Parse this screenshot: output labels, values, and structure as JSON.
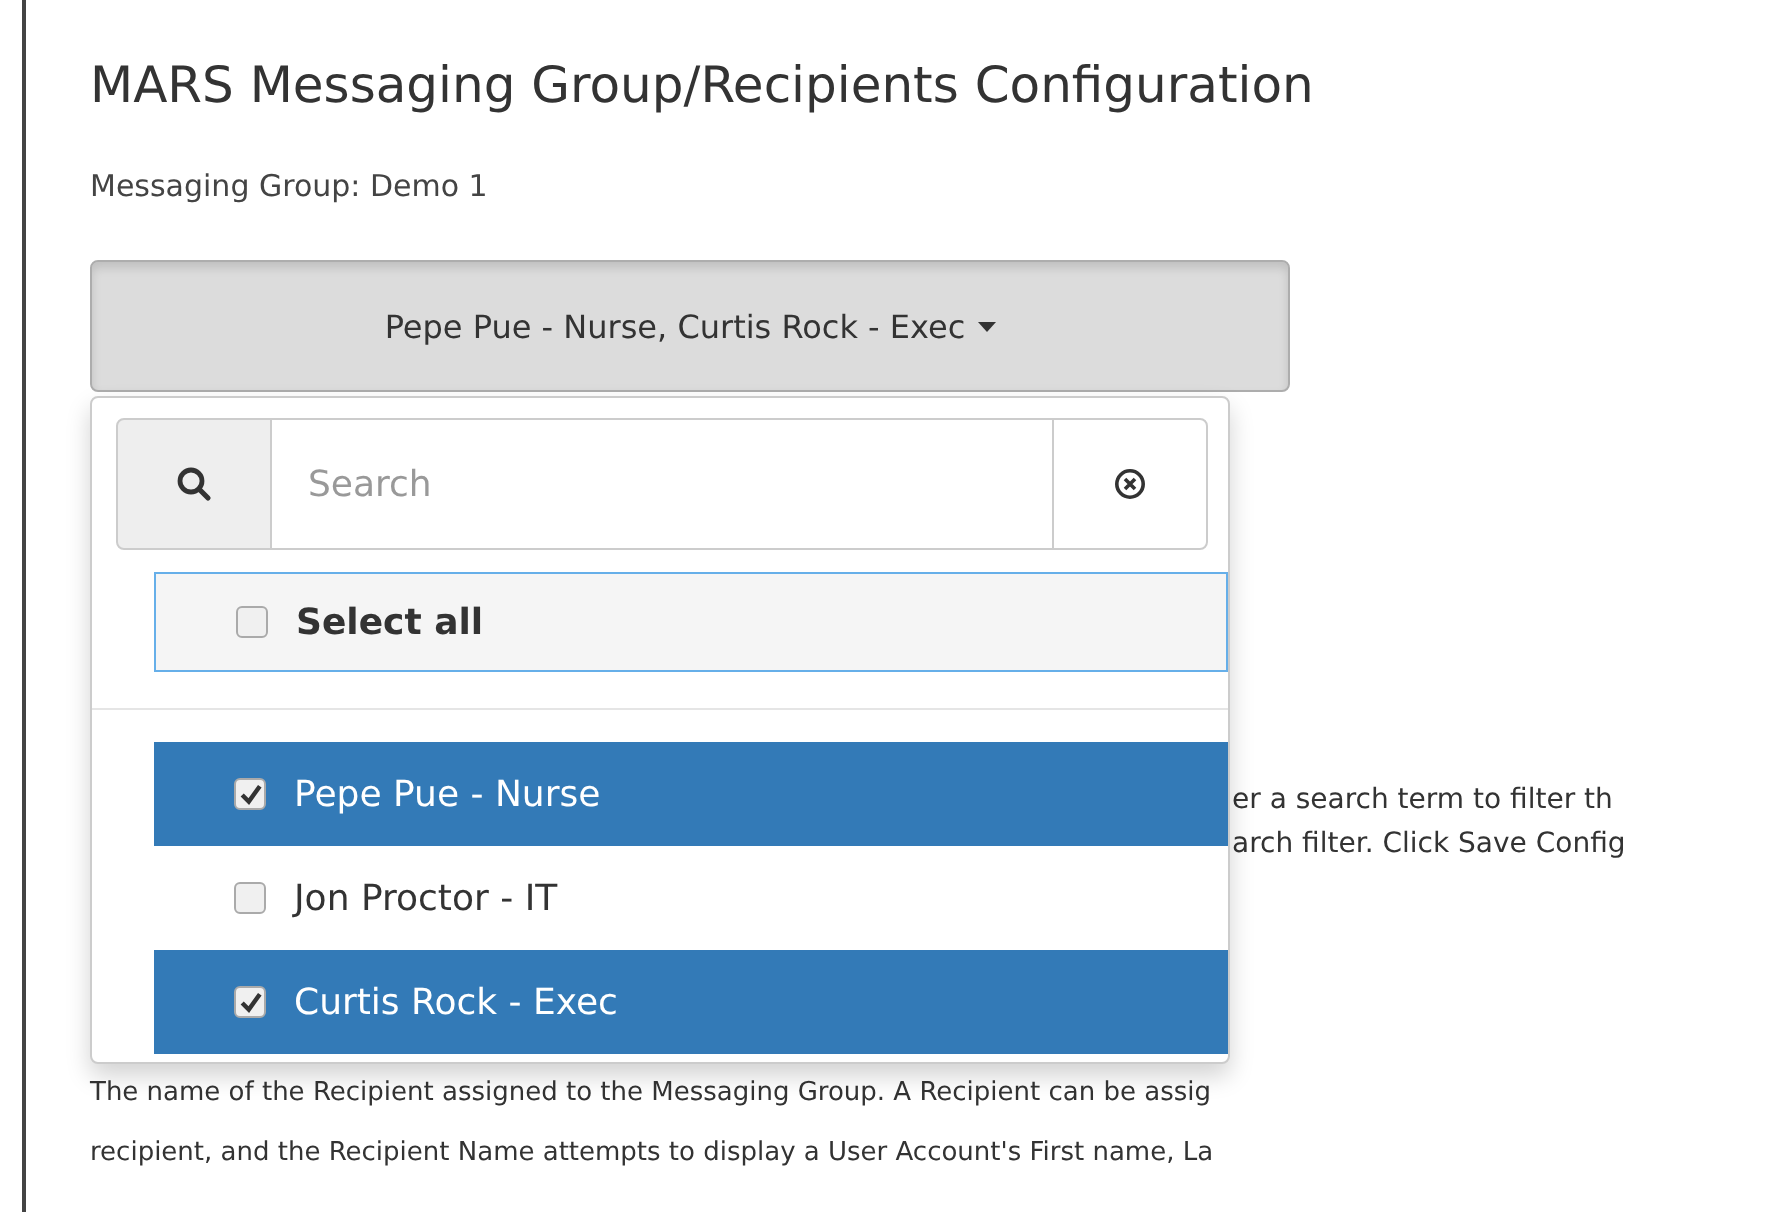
{
  "title": "MARS Messaging Group/Recipients Configuration",
  "group_label": "Messaging Group: Demo 1",
  "dropdown": {
    "button_label": "Pepe Pue - Nurse, Curtis Rock - Exec",
    "expanded": true,
    "search": {
      "placeholder": "Search"
    },
    "select_all": {
      "label": "Select all",
      "checked": false
    },
    "options": [
      {
        "label": "Pepe Pue - Nurse",
        "checked": true,
        "selected": true
      },
      {
        "label": "Jon Proctor - IT",
        "checked": false,
        "selected": false
      },
      {
        "label": "Curtis Rock - Exec",
        "checked": true,
        "selected": true
      }
    ]
  },
  "help_fragments": [
    "er a search term to filter th",
    "arch filter. Click Save Config"
  ],
  "description": [
    "The name of the Recipient assigned to the Messaging Group. A Recipient can be assig",
    "recipient, and the Recipient Name attempts to display a User Account's First name, La"
  ]
}
